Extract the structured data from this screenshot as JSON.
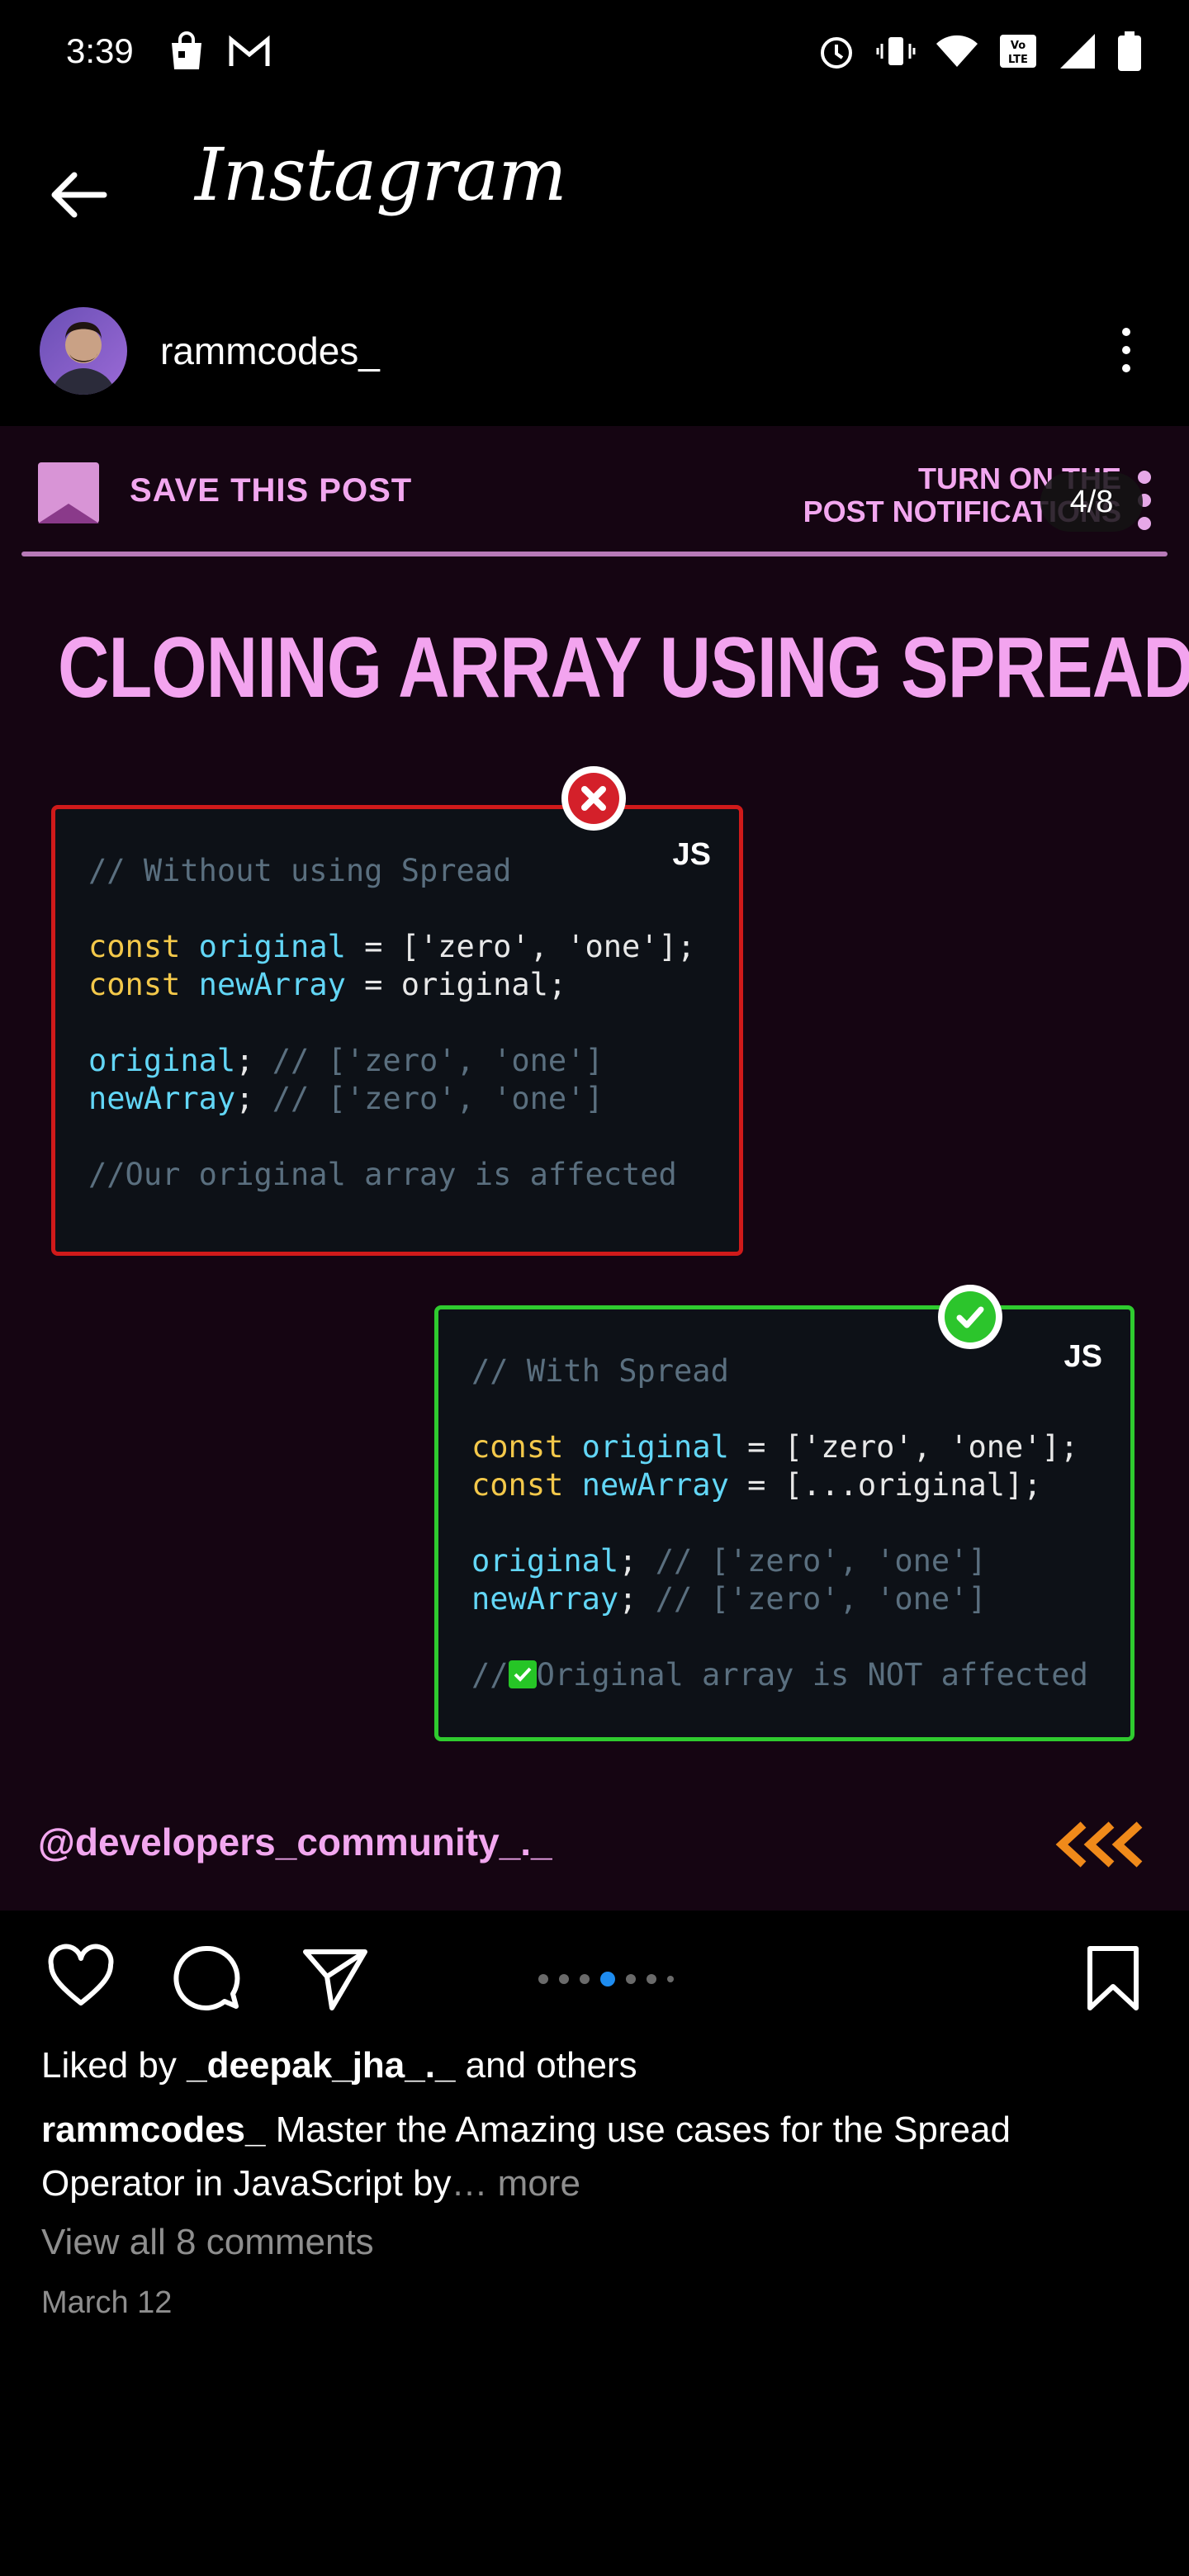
{
  "status_bar": {
    "time": "3:39"
  },
  "header": {
    "title": "Instagram"
  },
  "profile": {
    "username": "rammcodes_"
  },
  "post": {
    "save_label": "SAVE THIS POST",
    "notif_line1": "TURN ON THE",
    "notif_line2": "POST NOTIFICATIONS",
    "counter": "4/8",
    "headline": "CLONING ARRAY USING SPREAD",
    "bad_card": {
      "lang": "JS",
      "comment": "// Without using Spread",
      "line1_kw": "const",
      "line1_id": "original",
      "line1_rest": " = ['zero', 'one'];",
      "line2_kw": "const",
      "line2_id": "newArray",
      "line2_rest": " = original;",
      "line3_id": "original",
      "line3_rest": ";",
      "line3_comment": " // ['zero', 'one']",
      "line4_id": "newArray",
      "line4_rest": ";",
      "line4_comment": " // ['zero', 'one']",
      "footer": "//Our original array is affected"
    },
    "good_card": {
      "lang": "JS",
      "comment": "// With Spread",
      "line1_kw": "const",
      "line1_id": "original",
      "line1_rest": " = ['zero', 'one'];",
      "line2_kw": "const",
      "line2_id": "newArray",
      "line2_rest": " = [...original];",
      "line3_id": "original",
      "line3_rest": ";",
      "line3_comment": " // ['zero', 'one']",
      "line4_id": "newArray",
      "line4_rest": ";",
      "line4_comment": " // ['zero', 'one']",
      "footer_prefix": "//",
      "footer": "Original array is NOT affected"
    },
    "handle": "@developers_community_._"
  },
  "engagement": {
    "liked_prefix": "Liked by ",
    "liked_user": "_deepak_jha_._",
    "liked_suffix": " and others",
    "caption_user": "rammcodes_",
    "caption_text": " Master the Amazing use cases for the Spread Operator in JavaScript by",
    "caption_more": "… more",
    "comments": "View all 8 comments",
    "date": "March 12"
  },
  "carousel": {
    "total": 7,
    "active_index": 3
  },
  "colors": {
    "accent_pink": "#f2a7ef",
    "active_dot": "#1e8cf0",
    "error_red": "#d01a1a",
    "ok_green": "#2fcb2f"
  }
}
